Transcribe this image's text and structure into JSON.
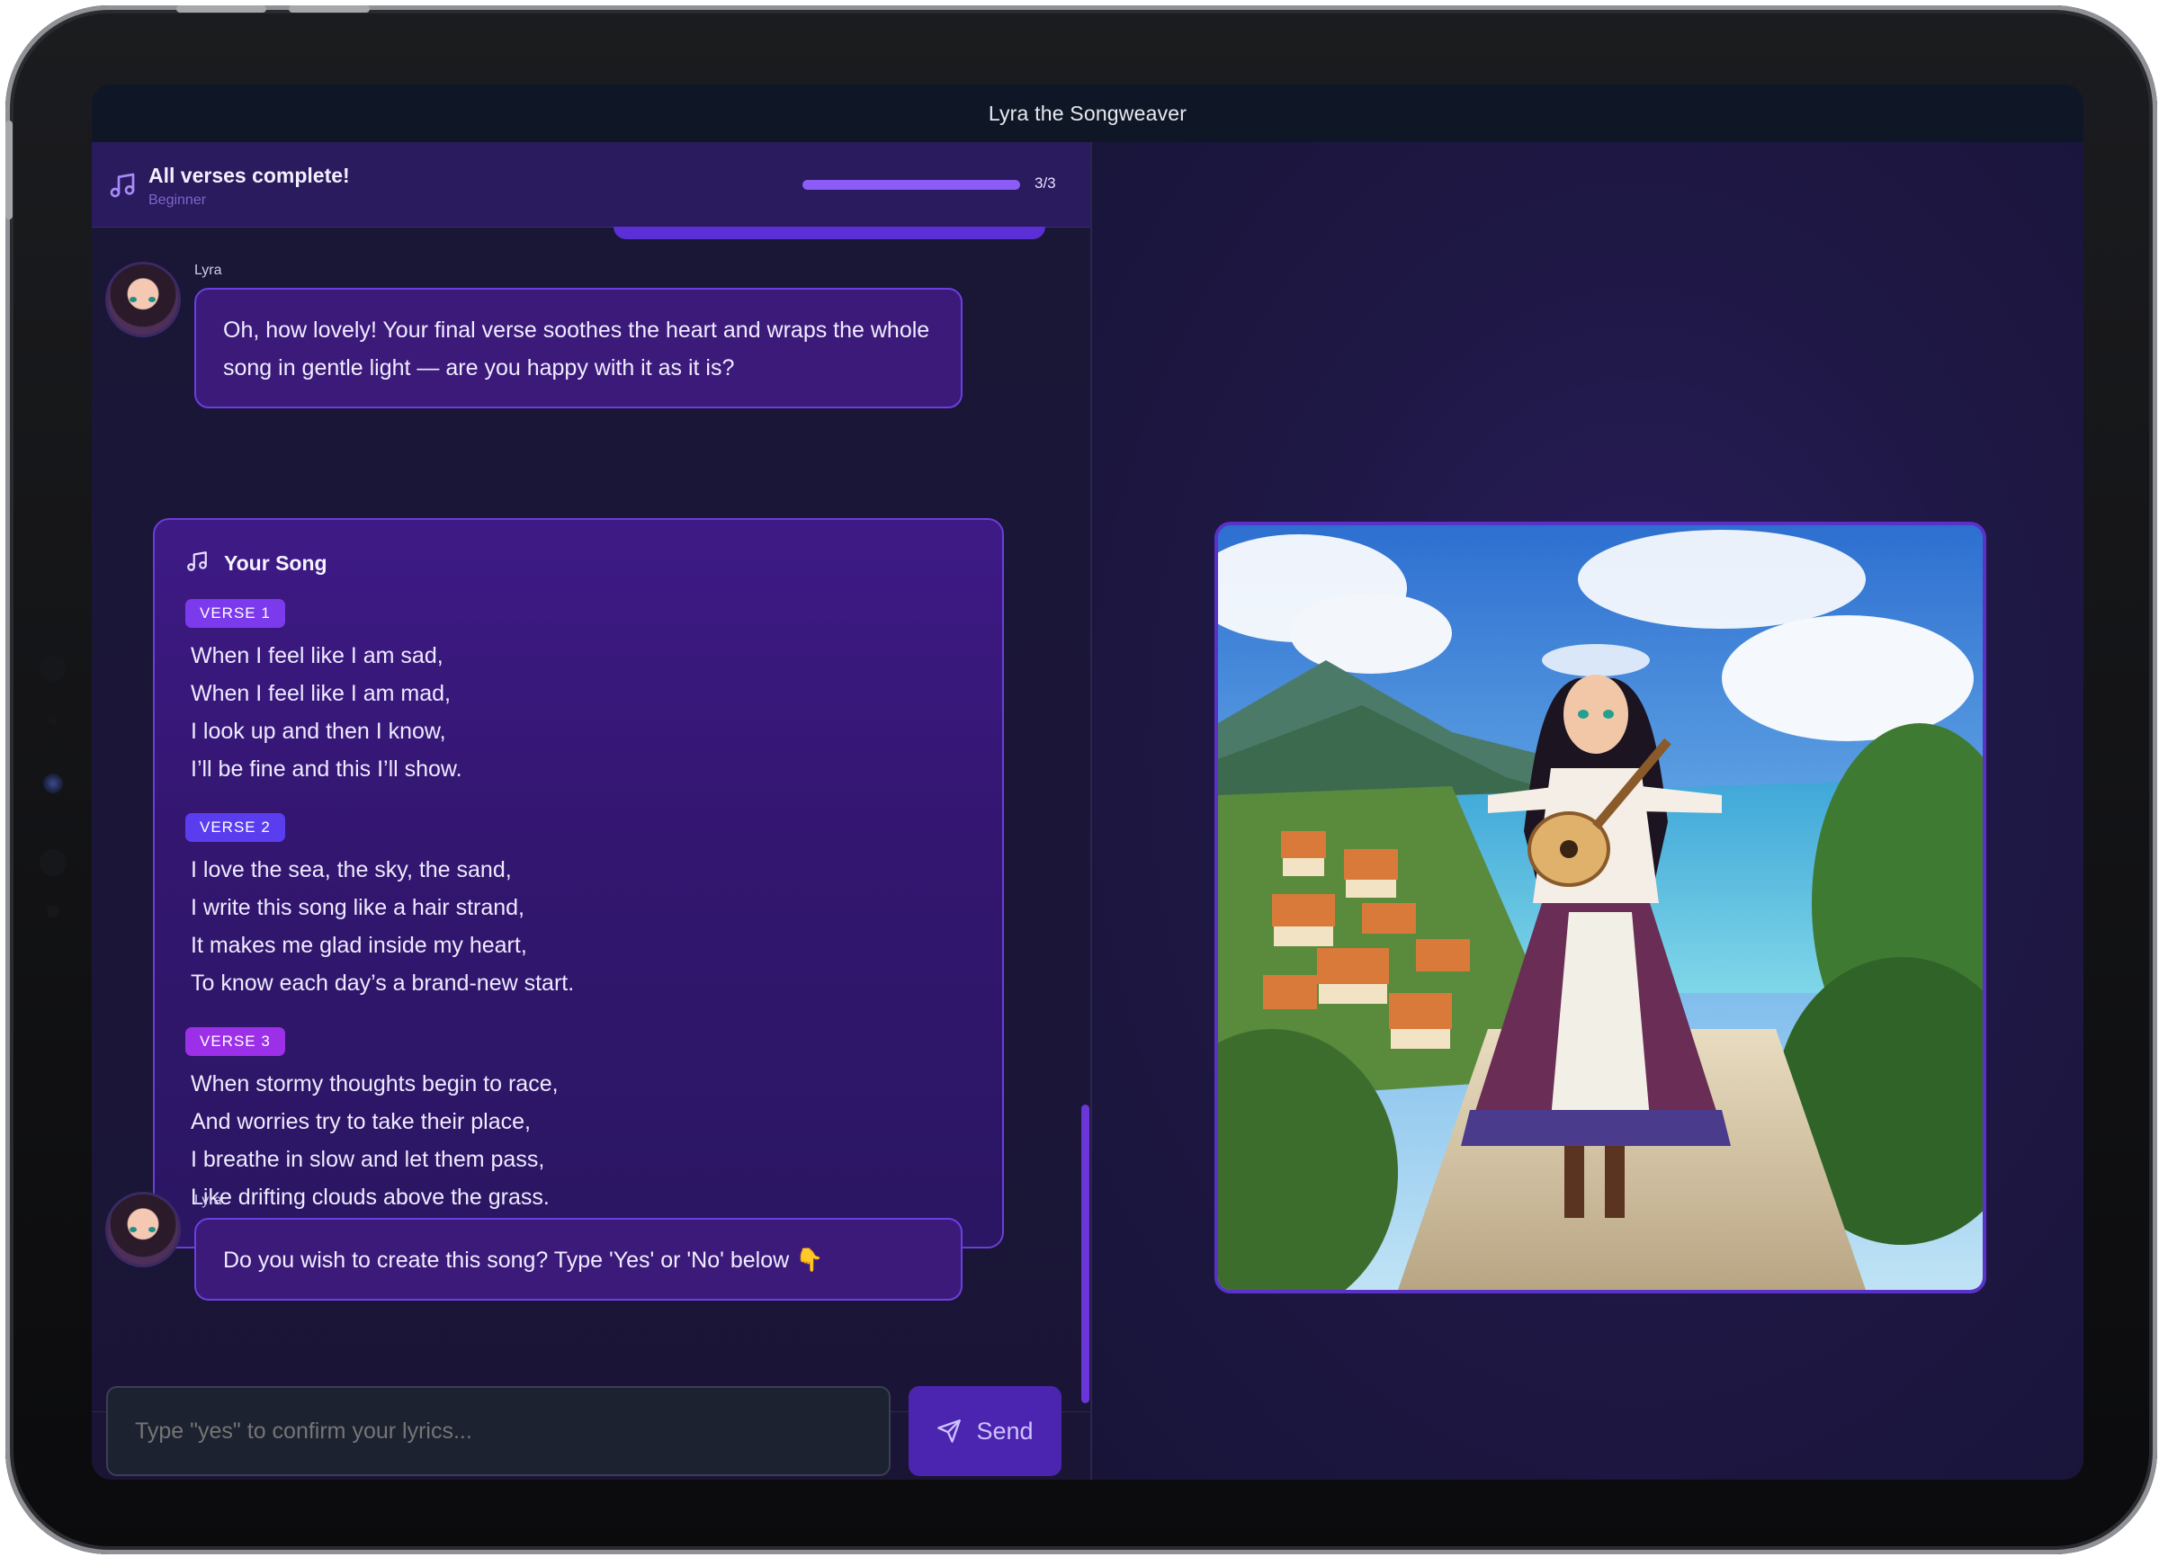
{
  "window": {
    "title": "Lyra the Songweaver"
  },
  "progress": {
    "title": "All verses complete!",
    "level": "Beginner",
    "count": "3/3",
    "fraction": 1.0
  },
  "messages": [
    {
      "sender": "Lyra",
      "text": "Oh, how lovely! Your final verse soothes the heart and wraps the whole song in gentle light — are you happy with it as it is?"
    },
    {
      "sender": "Lyra",
      "text": "Do you wish to create this song? Type 'Yes' or 'No' below 👇"
    }
  ],
  "song": {
    "title": "Your Song",
    "verses": [
      {
        "label": "VERSE 1",
        "color": "#7c3aed",
        "lines": [
          "When I feel like I am sad,",
          "When I feel like I am mad,",
          "I look up and then I know,",
          "I’ll be fine and this I’ll show."
        ]
      },
      {
        "label": "VERSE 2",
        "color": "#5b3df0",
        "lines": [
          "I love the sea, the sky, the sand,",
          "I write this song like a hair strand,",
          "It makes me glad inside my heart,",
          "To know each day’s a brand-new start."
        ]
      },
      {
        "label": "VERSE 3",
        "color": "#9b30e8",
        "lines": [
          "When stormy thoughts begin to race,",
          "And worries try to take their place,",
          "I breathe in slow and let them pass,",
          "Like drifting clouds above the grass."
        ]
      }
    ]
  },
  "composer": {
    "placeholder": "Type \"yes\" to confirm your lyrics...",
    "send_label": "Send"
  },
  "icons": {
    "progress": "music-note-icon",
    "song": "music-note-icon",
    "send": "paper-plane-icon"
  },
  "colors": {
    "accent": "#8b5cf6",
    "bubble": "#3b1a7a",
    "bubble_border": "#6b3fe0",
    "header": "#2a1a5e"
  }
}
